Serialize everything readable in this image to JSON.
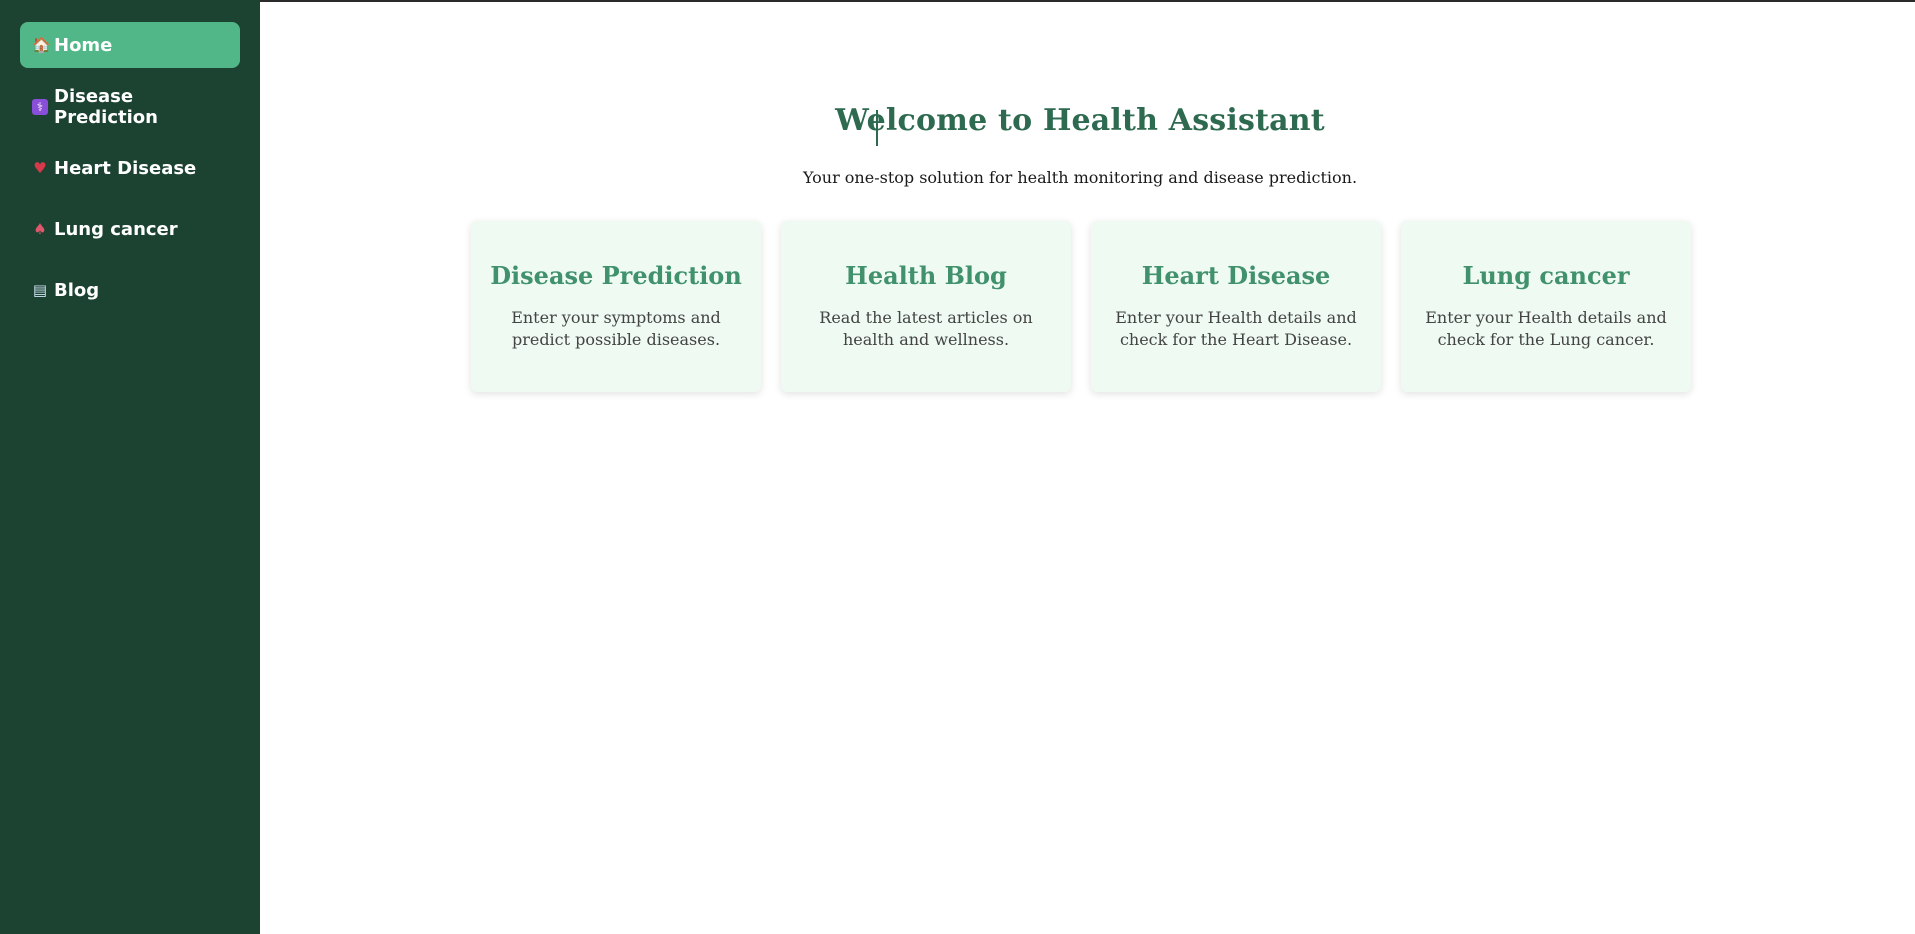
{
  "sidebar": {
    "items": [
      {
        "icon": "house-icon",
        "label": "Home",
        "active": true
      },
      {
        "icon": "medical-icon",
        "label": "Disease Prediction",
        "active": false
      },
      {
        "icon": "heart-icon",
        "label": "Heart Disease",
        "active": false
      },
      {
        "icon": "lungs-icon",
        "label": "Lung cancer",
        "active": false
      },
      {
        "icon": "book-icon",
        "label": "Blog",
        "active": false
      }
    ]
  },
  "main": {
    "title": "Welcome to Health Assistant",
    "subtitle": "Your one-stop solution for health monitoring and disease prediction.",
    "cards": [
      {
        "title": "Disease Prediction",
        "description": "Enter your symptoms and predict possible diseases."
      },
      {
        "title": "Health Blog",
        "description": "Read the latest articles on health and wellness."
      },
      {
        "title": "Heart Disease",
        "description": "Enter your Health details and check for the Heart Disease."
      },
      {
        "title": "Lung cancer",
        "description": "Enter your Health details and check for the Lung cancer."
      }
    ]
  },
  "colors": {
    "sidebar_bg": "#1c4332",
    "active_item": "#52b788",
    "title": "#2d6a4f",
    "card_title": "#40916c",
    "card_bg": "#eefaf2"
  }
}
